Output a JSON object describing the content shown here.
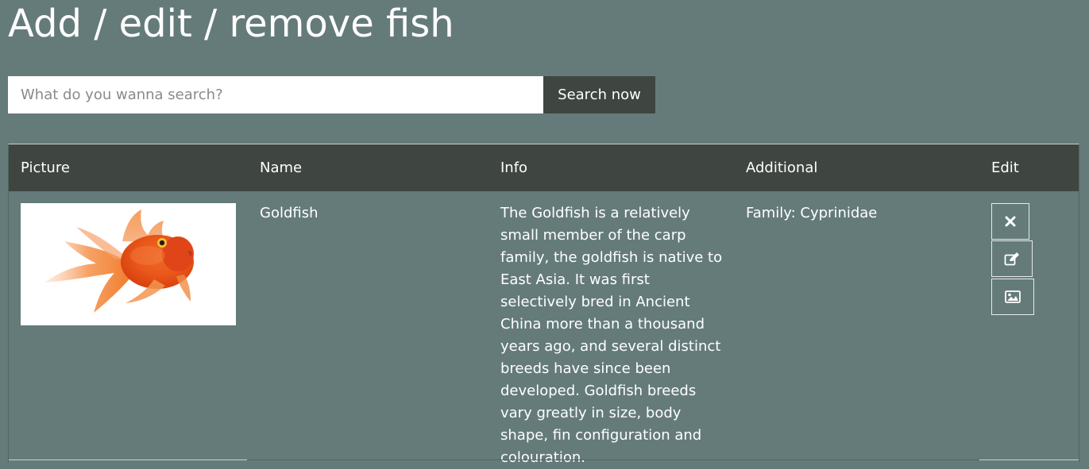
{
  "page": {
    "title": "Add / edit / remove fish"
  },
  "search": {
    "placeholder": "What do you wanna search?",
    "value": "",
    "button_label": "Search now"
  },
  "table": {
    "columns": [
      "Picture",
      "Name",
      "Info",
      "Additional",
      "Edit"
    ],
    "rows": [
      {
        "picture": "goldfish",
        "name": "Goldfish",
        "info": "The Goldfish is a relatively small member of the carp family, the goldfish is native to East Asia. It was first selectively bred in Ancient China more than a thousand years ago, and several distinct breeds have since been developed. Goldfish breeds vary greatly in size, body shape, fin configuration and colouration.",
        "additional": "Family: Cyprinidae",
        "actions": [
          "close-icon",
          "edit-icon",
          "image-icon"
        ]
      }
    ]
  },
  "colors": {
    "page_background": "#647b7a",
    "table_header_background": "#3f4540",
    "search_button_background": "#3f4540",
    "text": "#ffffff"
  }
}
